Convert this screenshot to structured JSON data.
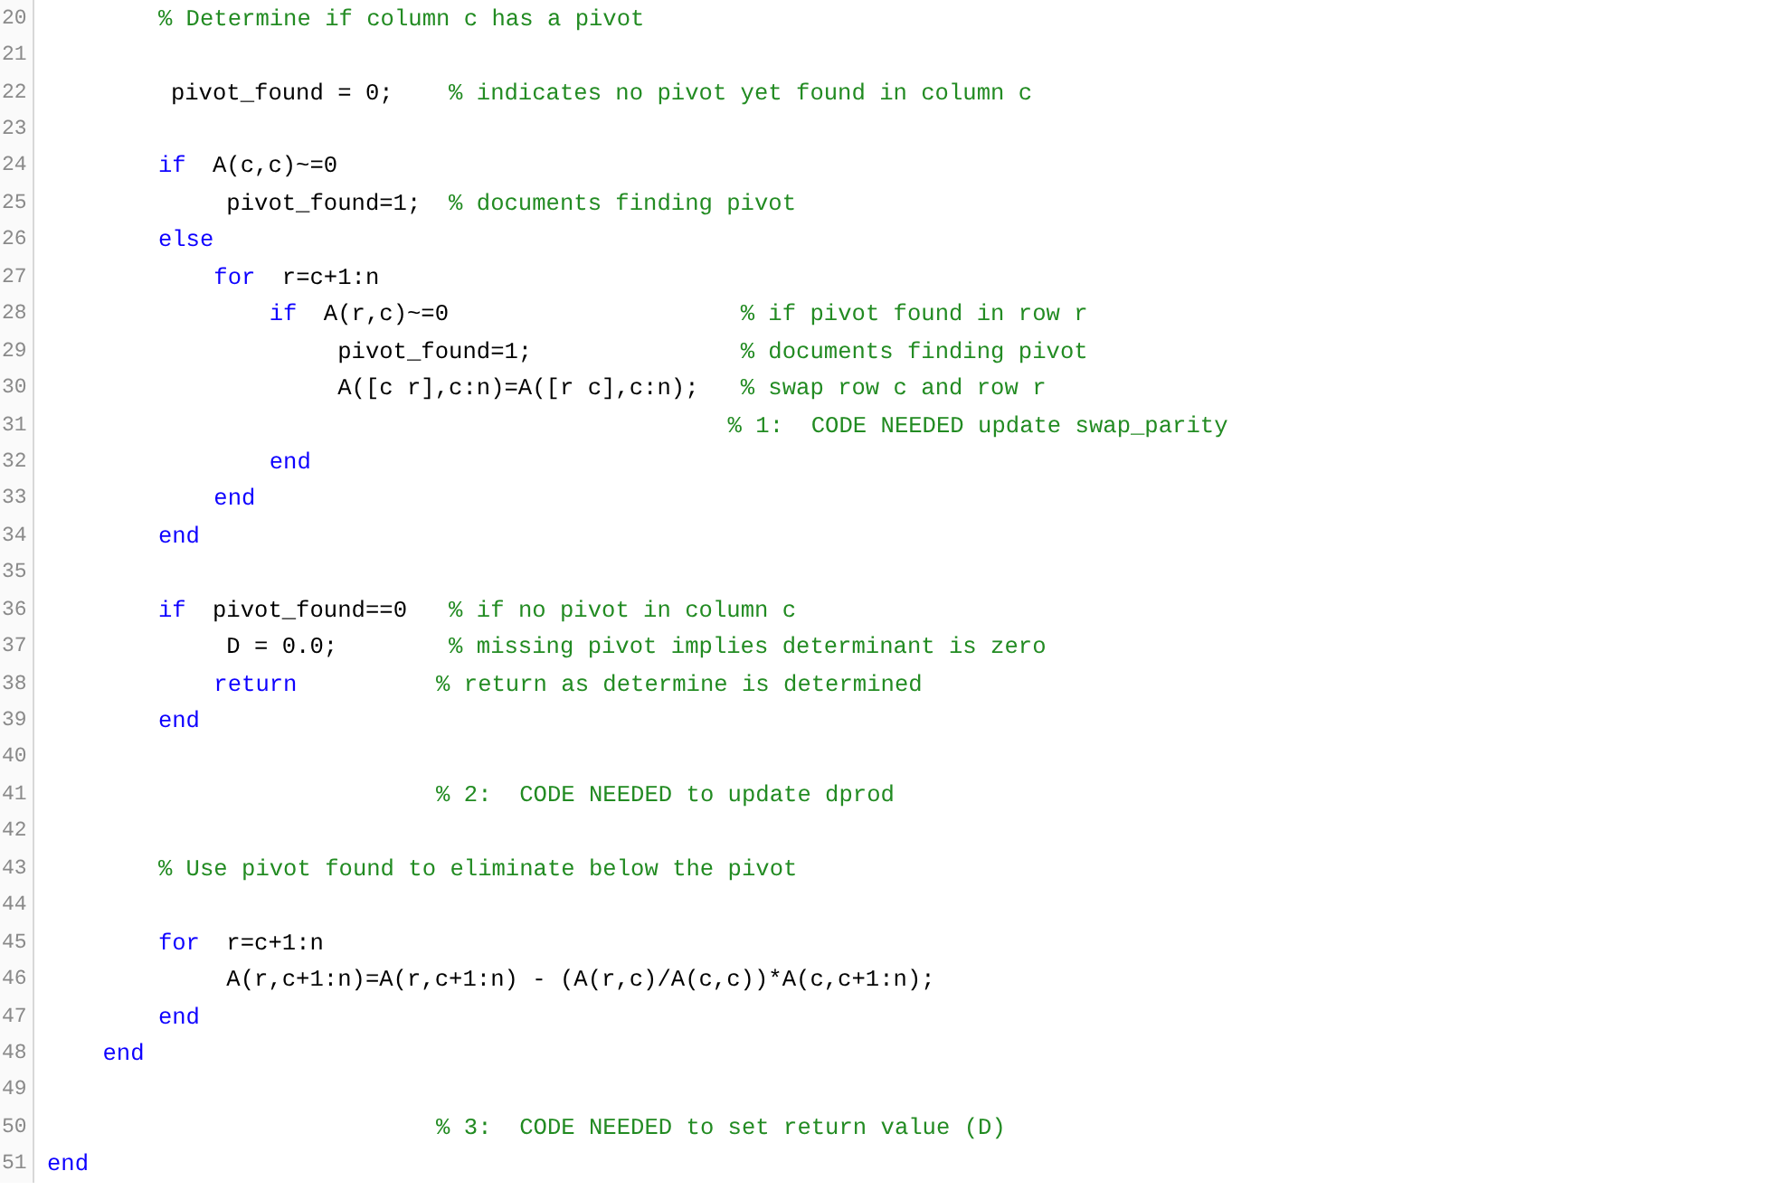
{
  "editor": {
    "lines": [
      {
        "number": "20",
        "segments": [
          {
            "kind": "comment",
            "text": "        % Determine if column c has a pivot"
          }
        ]
      },
      {
        "number": "21"
      },
      {
        "number": "22",
        "segments": [
          {
            "kind": "code",
            "text": "        pivot_found = 0;"
          },
          {
            "kind": "comment",
            "text": "    % indicates no pivot yet found in column c"
          }
        ]
      },
      {
        "number": "23"
      },
      {
        "number": "24",
        "segments": [
          {
            "kind": "keyword",
            "text": "        if"
          },
          {
            "kind": "code",
            "text": " A(c,c)~=0"
          }
        ]
      },
      {
        "number": "25",
        "segments": [
          {
            "kind": "code",
            "text": "            pivot_found=1;"
          },
          {
            "kind": "comment",
            "text": "  % documents finding pivot"
          }
        ]
      },
      {
        "number": "26",
        "segments": [
          {
            "kind": "keyword",
            "text": "        else"
          }
        ]
      },
      {
        "number": "27",
        "segments": [
          {
            "kind": "keyword",
            "text": "            for"
          },
          {
            "kind": "code",
            "text": " r=c+1:n"
          }
        ]
      },
      {
        "number": "28",
        "segments": [
          {
            "kind": "keyword",
            "text": "                if"
          },
          {
            "kind": "code",
            "text": " A(r,c)~=0"
          },
          {
            "kind": "comment",
            "text": "                     % if pivot found in row r"
          }
        ]
      },
      {
        "number": "29",
        "segments": [
          {
            "kind": "code",
            "text": "                    pivot_found=1;"
          },
          {
            "kind": "comment",
            "text": "               % documents finding pivot"
          }
        ]
      },
      {
        "number": "30",
        "segments": [
          {
            "kind": "code",
            "text": "                    A([c r],c:n)=A([r c],c:n);"
          },
          {
            "kind": "comment",
            "text": "   % swap row c and row r"
          }
        ]
      },
      {
        "number": "31",
        "segments": [
          {
            "kind": "comment",
            "text": "                                                 % 1:  CODE NEEDED update swap_parity"
          }
        ]
      },
      {
        "number": "32",
        "segments": [
          {
            "kind": "keyword",
            "text": "                end"
          }
        ]
      },
      {
        "number": "33",
        "segments": [
          {
            "kind": "keyword",
            "text": "            end"
          }
        ]
      },
      {
        "number": "34",
        "segments": [
          {
            "kind": "keyword",
            "text": "        end"
          }
        ]
      },
      {
        "number": "35"
      },
      {
        "number": "36",
        "segments": [
          {
            "kind": "keyword",
            "text": "        if"
          },
          {
            "kind": "code",
            "text": " pivot_found==0"
          },
          {
            "kind": "comment",
            "text": "   % if no pivot in column c"
          }
        ]
      },
      {
        "number": "37",
        "segments": [
          {
            "kind": "code",
            "text": "            D = 0.0;"
          },
          {
            "kind": "comment",
            "text": "        % missing pivot implies determinant is zero"
          }
        ]
      },
      {
        "number": "38",
        "segments": [
          {
            "kind": "keyword",
            "text": "            return"
          },
          {
            "kind": "comment",
            "text": "          % return as determine is determined"
          }
        ]
      },
      {
        "number": "39",
        "segments": [
          {
            "kind": "keyword",
            "text": "        end"
          }
        ]
      },
      {
        "number": "40"
      },
      {
        "number": "41",
        "segments": [
          {
            "kind": "comment",
            "text": "                            % 2:  CODE NEEDED to update dprod"
          }
        ]
      },
      {
        "number": "42"
      },
      {
        "number": "43",
        "segments": [
          {
            "kind": "comment",
            "text": "        % Use pivot found to eliminate below the pivot"
          }
        ]
      },
      {
        "number": "44"
      },
      {
        "number": "45",
        "segments": [
          {
            "kind": "keyword",
            "text": "        for"
          },
          {
            "kind": "code",
            "text": " r=c+1:n"
          }
        ]
      },
      {
        "number": "46",
        "segments": [
          {
            "kind": "code",
            "text": "            A(r,c+1:n)=A(r,c+1:n) - (A(r,c)/A(c,c))*A(c,c+1:n);"
          }
        ]
      },
      {
        "number": "47",
        "segments": [
          {
            "kind": "keyword",
            "text": "        end"
          }
        ]
      },
      {
        "number": "48",
        "segments": [
          {
            "kind": "keyword",
            "text": "    end"
          }
        ]
      },
      {
        "number": "49"
      },
      {
        "number": "50",
        "segments": [
          {
            "kind": "comment",
            "text": "                            % 3:  CODE NEEDED to set return value (D)"
          }
        ]
      },
      {
        "number": "51",
        "segments": [
          {
            "kind": "keyword",
            "text": "end"
          }
        ]
      }
    ]
  }
}
